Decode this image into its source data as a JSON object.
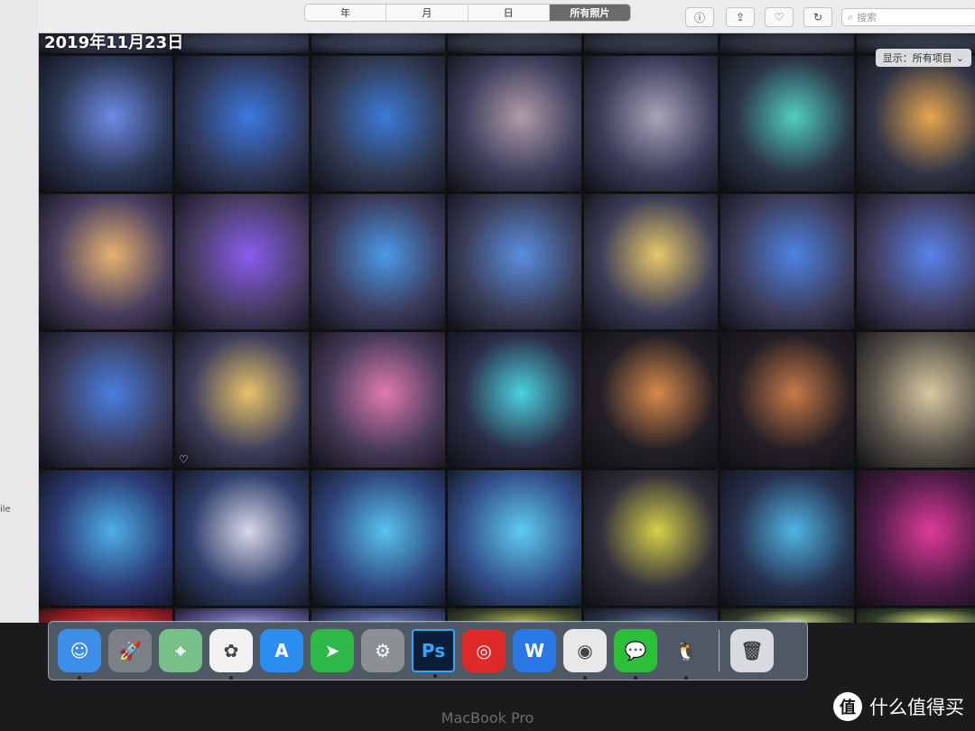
{
  "toolbar": {
    "segments": [
      "年",
      "月",
      "日",
      "所有照片"
    ],
    "active_segment": 3,
    "search_placeholder": "搜索",
    "buttons": [
      "info-icon",
      "share-icon",
      "heart-icon",
      "rotate-icon"
    ]
  },
  "sidebar": {
    "label_snippet": "ile"
  },
  "grid": {
    "date_header": "2019年11月23日",
    "show_filter": "显示：所有项目",
    "rows": [
      [
        {
          "bg": "#2c3243",
          "hl": "#3a4260"
        },
        {
          "bg": "#2f3547",
          "hl": "#3b435d"
        },
        {
          "bg": "#2f3547",
          "hl": "#3b435d"
        },
        {
          "bg": "#2e3341",
          "hl": "#393e4c"
        },
        {
          "bg": "#2c313f",
          "hl": "#383d4b"
        },
        {
          "bg": "#2b2f3c",
          "hl": "#373b48"
        },
        {
          "bg": "#2c3140",
          "hl": "#383c4a"
        }
      ],
      [
        {
          "bg": "#2c3754",
          "hl": "#6c8be4"
        },
        {
          "bg": "#2f395a",
          "hl": "#3d78e0"
        },
        {
          "bg": "#313a52",
          "hl": "#3c7ad8"
        },
        {
          "bg": "#3d3f5c",
          "hl": "#b29ba9"
        },
        {
          "bg": "#3b3d59",
          "hl": "#a9a4b8"
        },
        {
          "bg": "#2b3446",
          "hl": "#4fd0c0"
        },
        {
          "bg": "#2f3445",
          "hl": "#e8a64f"
        }
      ],
      [
        {
          "bg": "#4a4060",
          "hl": "#e8b370"
        },
        {
          "bg": "#463c60",
          "hl": "#8a5cf0"
        },
        {
          "bg": "#3b3c5c",
          "hl": "#4a9ae8"
        },
        {
          "bg": "#3a3f5a",
          "hl": "#5a8ee0"
        },
        {
          "bg": "#3c3d57",
          "hl": "#e8c86a"
        },
        {
          "bg": "#3d3e5c",
          "hl": "#4e82e4"
        },
        {
          "bg": "#403e5e",
          "hl": "#5a82ea"
        }
      ],
      [
        {
          "bg": "#3a3b5a",
          "hl": "#4a7ee0",
          "fav": false
        },
        {
          "bg": "#3e3e5c",
          "hl": "#e7c46a",
          "fav": true
        },
        {
          "bg": "#473b58",
          "hl": "#e07ab0",
          "fav": false
        },
        {
          "bg": "#2b2f48",
          "hl": "#4ad2e0",
          "fav": false
        },
        {
          "bg": "#231f26",
          "hl": "#d88a4a",
          "fav": false
        },
        {
          "bg": "#241f25",
          "hl": "#c87a48",
          "fav": false
        },
        {
          "bg": "#57524a",
          "hl": "#d9c9a0",
          "fav": false
        }
      ],
      [
        {
          "bg": "#2b3a73",
          "hl": "#4db0e8"
        },
        {
          "bg": "#2f3f6c",
          "hl": "#d9d9e8"
        },
        {
          "bg": "#2f467d",
          "hl": "#57c3ef"
        },
        {
          "bg": "#33508a",
          "hl": "#5ecbf1"
        },
        {
          "bg": "#2f2e3a",
          "hl": "#d7d04a"
        },
        {
          "bg": "#27314f",
          "hl": "#4fb6e4"
        },
        {
          "bg": "#4a1c44",
          "hl": "#e03a9a"
        }
      ],
      [
        {
          "bg": "#8a1a20",
          "hl": "#d23a3a"
        },
        {
          "bg": "#4b4678",
          "hl": "#8f88d0"
        },
        {
          "bg": "#39436b",
          "hl": "#6a79b8"
        },
        {
          "bg": "#39432b",
          "hl": "#aab04a"
        },
        {
          "bg": "#273046",
          "hl": "#5a6a8a"
        },
        {
          "bg": "#2f3b2a",
          "hl": "#c8d27a"
        },
        {
          "bg": "#2d3d26",
          "hl": "#d7e07a"
        }
      ]
    ]
  },
  "dock": {
    "items": [
      {
        "name": "finder-icon",
        "bg": "#3c8ee8",
        "glyph": "☺",
        "running": true
      },
      {
        "name": "launchpad-icon",
        "bg": "#7b7f86",
        "glyph": "🚀",
        "running": false
      },
      {
        "name": "maps-icon",
        "bg": "#78c08a",
        "glyph": "⌖",
        "running": false
      },
      {
        "name": "photos-icon",
        "bg": "#f2f2f2",
        "glyph": "✿",
        "running": true
      },
      {
        "name": "app-store-icon",
        "bg": "#2b8df0",
        "glyph": "A",
        "running": false
      },
      {
        "name": "paper-plane-app-icon",
        "bg": "#2fb84a",
        "glyph": "➤",
        "running": false
      },
      {
        "name": "system-preferences-icon",
        "bg": "#8c8f94",
        "glyph": "⚙",
        "running": false
      },
      {
        "name": "photoshop-icon",
        "bg": "#0a1e3a",
        "glyph": "Ps",
        "running": true
      },
      {
        "name": "netease-music-icon",
        "bg": "#e02a2a",
        "glyph": "◎",
        "running": false
      },
      {
        "name": "wps-office-icon",
        "bg": "#2a78e6",
        "glyph": "W",
        "running": false
      },
      {
        "name": "chrome-icon",
        "bg": "#e8e8e8",
        "glyph": "◉",
        "running": true
      },
      {
        "name": "wechat-icon",
        "bg": "#2dbe3a",
        "glyph": "💬",
        "running": true
      },
      {
        "name": "qq-icon",
        "bg": "transparent",
        "glyph": "🐧",
        "running": true
      },
      {
        "name": "trash-icon",
        "bg": "#d8dbe0",
        "glyph": "🗑",
        "running": false
      }
    ]
  },
  "device": {
    "brand": "MacBook Pro"
  },
  "watermark": {
    "logo": "值",
    "text": "什么值得买"
  }
}
